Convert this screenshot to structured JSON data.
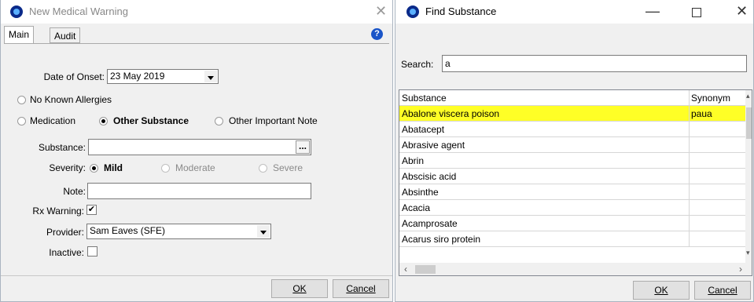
{
  "warning_dialog": {
    "title": "New Medical Warning",
    "tabs": [
      "Main",
      "Audit"
    ],
    "help_glyph": "?",
    "date_of_onset_label": "Date of Onset:",
    "date_of_onset_value": "23 May 2019",
    "no_known_allergies": "No Known Allergies",
    "medication": "Medication",
    "other_substance": "Other Substance",
    "other_important_note": "Other Important Note",
    "substance_label": "Substance:",
    "substance_value": "",
    "browse_label": "...",
    "severity_label": "Severity:",
    "severity_mild": "Mild",
    "severity_moderate": "Moderate",
    "severity_severe": "Severe",
    "note_label": "Note:",
    "note_value": "",
    "rx_warning_label": "Rx Warning:",
    "rx_warning_checked": true,
    "provider_label": "Provider:",
    "provider_value": "Sam Eaves (SFE)",
    "inactive_label": "Inactive:",
    "inactive_checked": false,
    "ok_label": "OK",
    "cancel_label": "Cancel"
  },
  "find_dialog": {
    "title": "Find Substance",
    "search_label": "Search:",
    "search_value": "a",
    "col_substance": "Substance",
    "col_synonym": "Synonym",
    "rows": [
      {
        "substance": "Abalone viscera poison",
        "synonym": "paua"
      },
      {
        "substance": "Abatacept",
        "synonym": ""
      },
      {
        "substance": "Abrasive agent",
        "synonym": ""
      },
      {
        "substance": "Abrin",
        "synonym": ""
      },
      {
        "substance": "Abscisic acid",
        "synonym": ""
      },
      {
        "substance": "Absinthe",
        "synonym": ""
      },
      {
        "substance": "Acacia",
        "synonym": ""
      },
      {
        "substance": "Acamprosate",
        "synonym": ""
      },
      {
        "substance": "Acarus siro protein",
        "synonym": ""
      }
    ],
    "ok_label": "OK",
    "cancel_label": "Cancel"
  },
  "colors": {
    "selected_row": "#ffff26",
    "app_icon": "#0a2a8a",
    "help": "#1a55c8"
  }
}
